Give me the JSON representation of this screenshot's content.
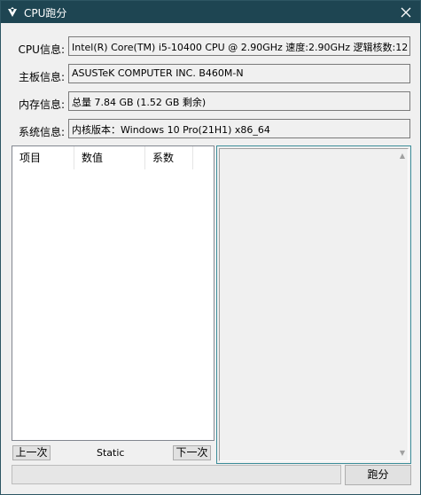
{
  "window": {
    "title": "CPU跑分",
    "close_glyph": "✕"
  },
  "info": {
    "cpu": {
      "label": "CPU信息:",
      "value": "Intel(R) Core(TM) i5-10400 CPU @ 2.90GHz 速度:2.90GHz 逻辑核数:12"
    },
    "board": {
      "label": "主板信息:",
      "value": "ASUSTeK COMPUTER INC. B460M-N"
    },
    "memory": {
      "label": "内存信息:",
      "value": "总量 7.84 GB (1.52 GB 剩余)"
    },
    "system": {
      "label": "系统信息:",
      "value": "内核版本：Windows 10 Pro(21H1) x86_64"
    }
  },
  "list": {
    "columns": [
      "项目",
      "数值",
      "系数"
    ],
    "rows": []
  },
  "nav": {
    "prev_label": "上一次",
    "next_label": "下一次",
    "static_label": "Static"
  },
  "run_label": "跑分",
  "progress": {
    "percent": 0
  },
  "colors": {
    "titlebar": "#1e4552",
    "window_bg": "#f0f0f0",
    "panel_border": "#3c8d99"
  }
}
